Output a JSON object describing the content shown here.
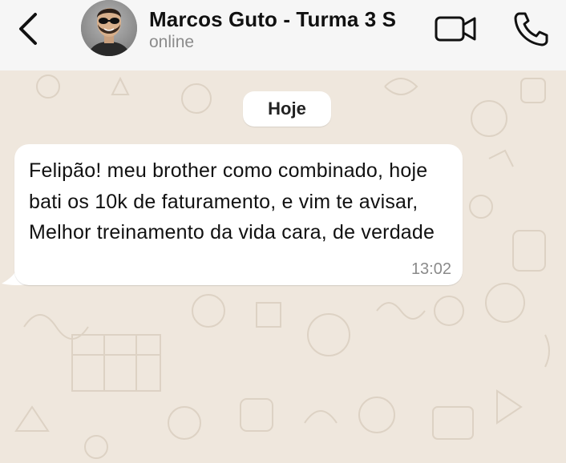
{
  "header": {
    "contact_name": "Marcos Guto - Turma 3 S",
    "status": "online",
    "icons": {
      "back": "chevron-left-icon",
      "video": "video-camera-icon",
      "call": "phone-icon"
    }
  },
  "chat": {
    "date_label": "Hoje",
    "messages": [
      {
        "direction": "incoming",
        "text": "Felipão! meu brother como combinado, hoje bati os 10k de faturamento, e vim te avisar, Melhor treinamento da vida cara, de verdade",
        "time": "13:02"
      }
    ]
  },
  "colors": {
    "header_bg": "#f6f6f6",
    "chat_bg": "#efe7dd",
    "bubble_bg": "#ffffff",
    "secondary_text": "#8b8b8b"
  }
}
